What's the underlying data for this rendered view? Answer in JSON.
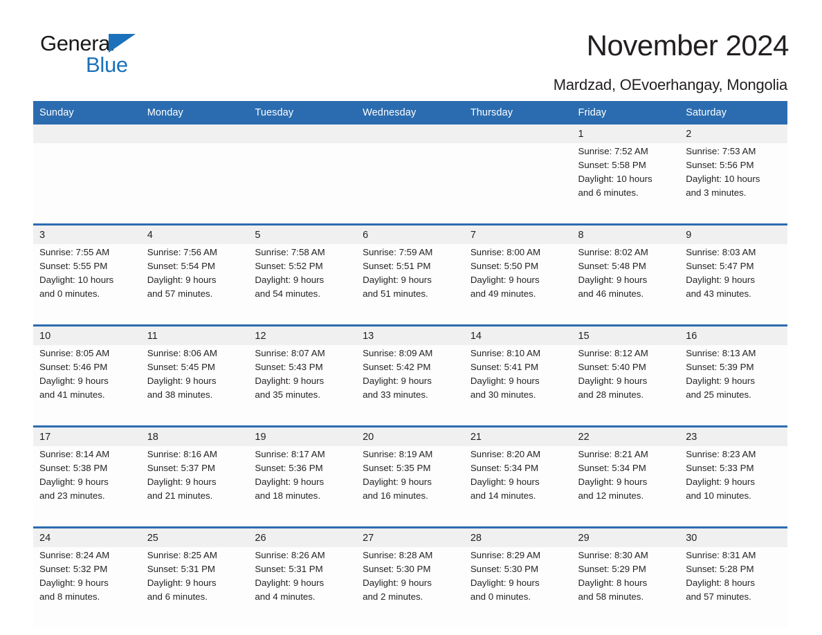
{
  "logo": {
    "word1": "General",
    "word2": "Blue",
    "triangle_color": "#1c72ba"
  },
  "header": {
    "title": "November 2024",
    "location": "Mardzad, OEvoerhangay, Mongolia"
  },
  "theme": {
    "header_blue": "#2b6cb0",
    "daynum_band": "#f0f0f0",
    "cell_background": "#fdfdfd",
    "text": "#231f20"
  },
  "weekday_headers": [
    "Sunday",
    "Monday",
    "Tuesday",
    "Wednesday",
    "Thursday",
    "Friday",
    "Saturday"
  ],
  "weeks": [
    [
      {
        "day": "",
        "sunrise": "",
        "sunset": "",
        "daylight_line1": "",
        "daylight_line2": ""
      },
      {
        "day": "",
        "sunrise": "",
        "sunset": "",
        "daylight_line1": "",
        "daylight_line2": ""
      },
      {
        "day": "",
        "sunrise": "",
        "sunset": "",
        "daylight_line1": "",
        "daylight_line2": ""
      },
      {
        "day": "",
        "sunrise": "",
        "sunset": "",
        "daylight_line1": "",
        "daylight_line2": ""
      },
      {
        "day": "",
        "sunrise": "",
        "sunset": "",
        "daylight_line1": "",
        "daylight_line2": ""
      },
      {
        "day": "1",
        "sunrise": "Sunrise: 7:52 AM",
        "sunset": "Sunset: 5:58 PM",
        "daylight_line1": "Daylight: 10 hours",
        "daylight_line2": "and 6 minutes."
      },
      {
        "day": "2",
        "sunrise": "Sunrise: 7:53 AM",
        "sunset": "Sunset: 5:56 PM",
        "daylight_line1": "Daylight: 10 hours",
        "daylight_line2": "and 3 minutes."
      }
    ],
    [
      {
        "day": "3",
        "sunrise": "Sunrise: 7:55 AM",
        "sunset": "Sunset: 5:55 PM",
        "daylight_line1": "Daylight: 10 hours",
        "daylight_line2": "and 0 minutes."
      },
      {
        "day": "4",
        "sunrise": "Sunrise: 7:56 AM",
        "sunset": "Sunset: 5:54 PM",
        "daylight_line1": "Daylight: 9 hours",
        "daylight_line2": "and 57 minutes."
      },
      {
        "day": "5",
        "sunrise": "Sunrise: 7:58 AM",
        "sunset": "Sunset: 5:52 PM",
        "daylight_line1": "Daylight: 9 hours",
        "daylight_line2": "and 54 minutes."
      },
      {
        "day": "6",
        "sunrise": "Sunrise: 7:59 AM",
        "sunset": "Sunset: 5:51 PM",
        "daylight_line1": "Daylight: 9 hours",
        "daylight_line2": "and 51 minutes."
      },
      {
        "day": "7",
        "sunrise": "Sunrise: 8:00 AM",
        "sunset": "Sunset: 5:50 PM",
        "daylight_line1": "Daylight: 9 hours",
        "daylight_line2": "and 49 minutes."
      },
      {
        "day": "8",
        "sunrise": "Sunrise: 8:02 AM",
        "sunset": "Sunset: 5:48 PM",
        "daylight_line1": "Daylight: 9 hours",
        "daylight_line2": "and 46 minutes."
      },
      {
        "day": "9",
        "sunrise": "Sunrise: 8:03 AM",
        "sunset": "Sunset: 5:47 PM",
        "daylight_line1": "Daylight: 9 hours",
        "daylight_line2": "and 43 minutes."
      }
    ],
    [
      {
        "day": "10",
        "sunrise": "Sunrise: 8:05 AM",
        "sunset": "Sunset: 5:46 PM",
        "daylight_line1": "Daylight: 9 hours",
        "daylight_line2": "and 41 minutes."
      },
      {
        "day": "11",
        "sunrise": "Sunrise: 8:06 AM",
        "sunset": "Sunset: 5:45 PM",
        "daylight_line1": "Daylight: 9 hours",
        "daylight_line2": "and 38 minutes."
      },
      {
        "day": "12",
        "sunrise": "Sunrise: 8:07 AM",
        "sunset": "Sunset: 5:43 PM",
        "daylight_line1": "Daylight: 9 hours",
        "daylight_line2": "and 35 minutes."
      },
      {
        "day": "13",
        "sunrise": "Sunrise: 8:09 AM",
        "sunset": "Sunset: 5:42 PM",
        "daylight_line1": "Daylight: 9 hours",
        "daylight_line2": "and 33 minutes."
      },
      {
        "day": "14",
        "sunrise": "Sunrise: 8:10 AM",
        "sunset": "Sunset: 5:41 PM",
        "daylight_line1": "Daylight: 9 hours",
        "daylight_line2": "and 30 minutes."
      },
      {
        "day": "15",
        "sunrise": "Sunrise: 8:12 AM",
        "sunset": "Sunset: 5:40 PM",
        "daylight_line1": "Daylight: 9 hours",
        "daylight_line2": "and 28 minutes."
      },
      {
        "day": "16",
        "sunrise": "Sunrise: 8:13 AM",
        "sunset": "Sunset: 5:39 PM",
        "daylight_line1": "Daylight: 9 hours",
        "daylight_line2": "and 25 minutes."
      }
    ],
    [
      {
        "day": "17",
        "sunrise": "Sunrise: 8:14 AM",
        "sunset": "Sunset: 5:38 PM",
        "daylight_line1": "Daylight: 9 hours",
        "daylight_line2": "and 23 minutes."
      },
      {
        "day": "18",
        "sunrise": "Sunrise: 8:16 AM",
        "sunset": "Sunset: 5:37 PM",
        "daylight_line1": "Daylight: 9 hours",
        "daylight_line2": "and 21 minutes."
      },
      {
        "day": "19",
        "sunrise": "Sunrise: 8:17 AM",
        "sunset": "Sunset: 5:36 PM",
        "daylight_line1": "Daylight: 9 hours",
        "daylight_line2": "and 18 minutes."
      },
      {
        "day": "20",
        "sunrise": "Sunrise: 8:19 AM",
        "sunset": "Sunset: 5:35 PM",
        "daylight_line1": "Daylight: 9 hours",
        "daylight_line2": "and 16 minutes."
      },
      {
        "day": "21",
        "sunrise": "Sunrise: 8:20 AM",
        "sunset": "Sunset: 5:34 PM",
        "daylight_line1": "Daylight: 9 hours",
        "daylight_line2": "and 14 minutes."
      },
      {
        "day": "22",
        "sunrise": "Sunrise: 8:21 AM",
        "sunset": "Sunset: 5:34 PM",
        "daylight_line1": "Daylight: 9 hours",
        "daylight_line2": "and 12 minutes."
      },
      {
        "day": "23",
        "sunrise": "Sunrise: 8:23 AM",
        "sunset": "Sunset: 5:33 PM",
        "daylight_line1": "Daylight: 9 hours",
        "daylight_line2": "and 10 minutes."
      }
    ],
    [
      {
        "day": "24",
        "sunrise": "Sunrise: 8:24 AM",
        "sunset": "Sunset: 5:32 PM",
        "daylight_line1": "Daylight: 9 hours",
        "daylight_line2": "and 8 minutes."
      },
      {
        "day": "25",
        "sunrise": "Sunrise: 8:25 AM",
        "sunset": "Sunset: 5:31 PM",
        "daylight_line1": "Daylight: 9 hours",
        "daylight_line2": "and 6 minutes."
      },
      {
        "day": "26",
        "sunrise": "Sunrise: 8:26 AM",
        "sunset": "Sunset: 5:31 PM",
        "daylight_line1": "Daylight: 9 hours",
        "daylight_line2": "and 4 minutes."
      },
      {
        "day": "27",
        "sunrise": "Sunrise: 8:28 AM",
        "sunset": "Sunset: 5:30 PM",
        "daylight_line1": "Daylight: 9 hours",
        "daylight_line2": "and 2 minutes."
      },
      {
        "day": "28",
        "sunrise": "Sunrise: 8:29 AM",
        "sunset": "Sunset: 5:30 PM",
        "daylight_line1": "Daylight: 9 hours",
        "daylight_line2": "and 0 minutes."
      },
      {
        "day": "29",
        "sunrise": "Sunrise: 8:30 AM",
        "sunset": "Sunset: 5:29 PM",
        "daylight_line1": "Daylight: 8 hours",
        "daylight_line2": "and 58 minutes."
      },
      {
        "day": "30",
        "sunrise": "Sunrise: 8:31 AM",
        "sunset": "Sunset: 5:28 PM",
        "daylight_line1": "Daylight: 8 hours",
        "daylight_line2": "and 57 minutes."
      }
    ]
  ]
}
